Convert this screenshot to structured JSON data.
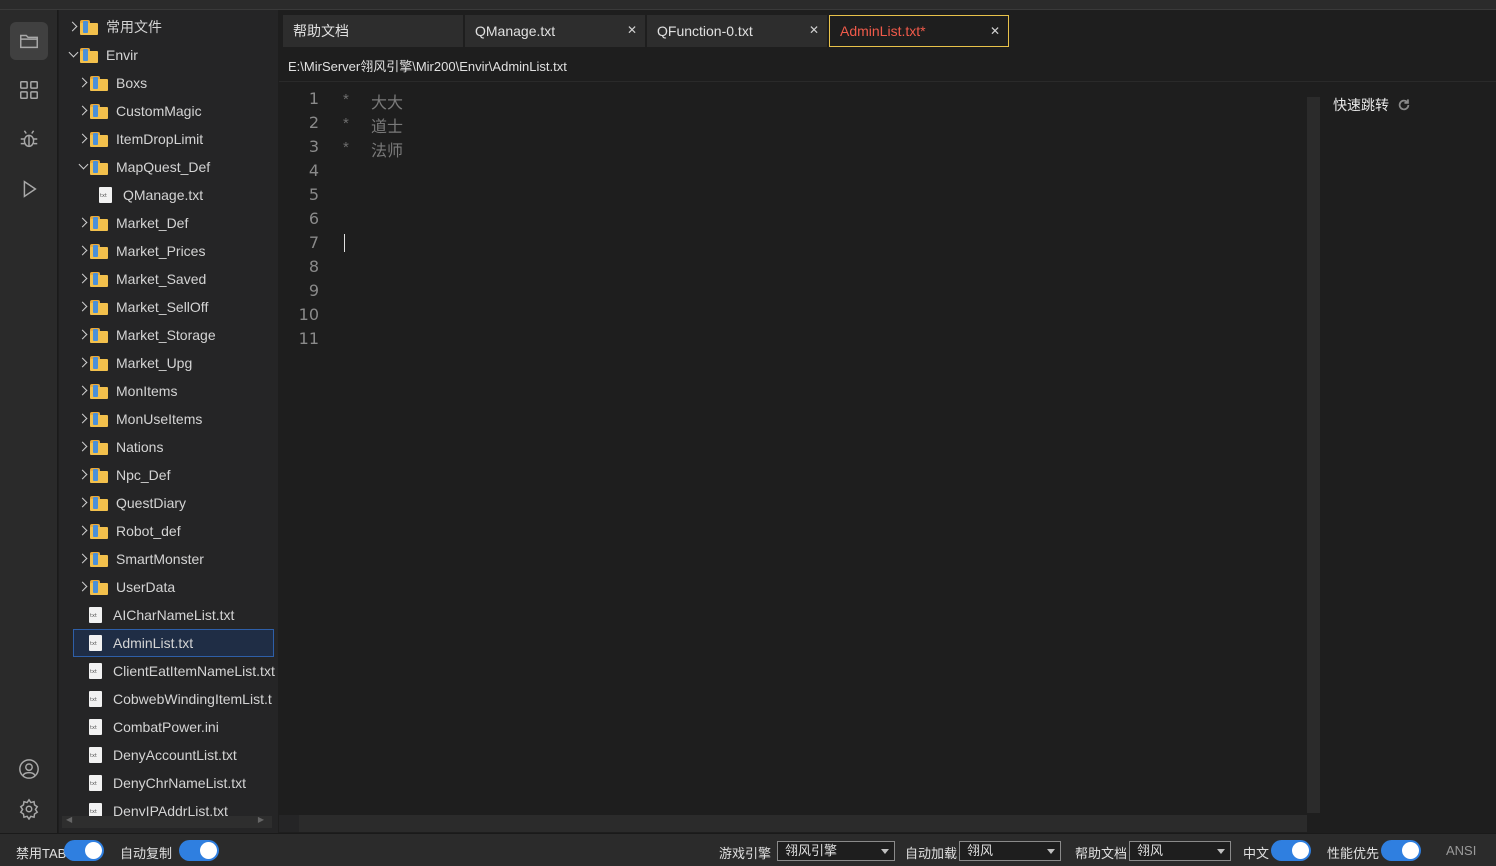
{
  "tree": [
    {
      "label": "常用文件",
      "type": "folder",
      "chev": "right"
    },
    {
      "label": "Envir",
      "type": "folder",
      "chev": "open"
    },
    {
      "label": "Boxs",
      "type": "folder",
      "chev": "right"
    },
    {
      "label": "CustomMagic",
      "type": "folder",
      "chev": "right"
    },
    {
      "label": "ItemDropLimit",
      "type": "folder",
      "chev": "right"
    },
    {
      "label": "MapQuest_Def",
      "type": "folder",
      "chev": "open"
    },
    {
      "label": "QManage.txt",
      "type": "file",
      "chev": "none"
    },
    {
      "label": "Market_Def",
      "type": "folder",
      "chev": "right"
    },
    {
      "label": "Market_Prices",
      "type": "folder",
      "chev": "right"
    },
    {
      "label": "Market_Saved",
      "type": "folder",
      "chev": "right"
    },
    {
      "label": "Market_SellOff",
      "type": "folder",
      "chev": "right"
    },
    {
      "label": "Market_Storage",
      "type": "folder",
      "chev": "right"
    },
    {
      "label": "Market_Upg",
      "type": "folder",
      "chev": "right"
    },
    {
      "label": "MonItems",
      "type": "folder",
      "chev": "right"
    },
    {
      "label": "MonUseItems",
      "type": "folder",
      "chev": "right"
    },
    {
      "label": "Nations",
      "type": "folder",
      "chev": "right"
    },
    {
      "label": "Npc_Def",
      "type": "folder",
      "chev": "right"
    },
    {
      "label": "QuestDiary",
      "type": "folder",
      "chev": "right"
    },
    {
      "label": "Robot_def",
      "type": "folder",
      "chev": "right"
    },
    {
      "label": "SmartMonster",
      "type": "folder",
      "chev": "right"
    },
    {
      "label": "UserData",
      "type": "folder",
      "chev": "right"
    },
    {
      "label": "AICharNameList.txt",
      "type": "file",
      "chev": "none"
    },
    {
      "label": "AdminList.txt",
      "type": "file",
      "chev": "none",
      "selected": true
    },
    {
      "label": "ClientEatItemNameList.txt",
      "type": "file",
      "chev": "none"
    },
    {
      "label": "CobwebWindingItemList.t",
      "type": "file",
      "chev": "none"
    },
    {
      "label": "CombatPower.ini",
      "type": "file",
      "chev": "none"
    },
    {
      "label": "DenyAccountList.txt",
      "type": "file",
      "chev": "none"
    },
    {
      "label": "DenyChrNameList.txt",
      "type": "file",
      "chev": "none"
    },
    {
      "label": "DenyIPAddrList.txt",
      "type": "file",
      "chev": "none"
    }
  ],
  "tabs": [
    {
      "label": "帮助文档",
      "closable": false
    },
    {
      "label": "QManage.txt",
      "closable": true
    },
    {
      "label": "QFunction-0.txt",
      "closable": true
    },
    {
      "label": "AdminList.txt*",
      "closable": true,
      "active": true
    }
  ],
  "path": "E:\\MirServer翎风引擎\\Mir200\\Envir\\AdminList.txt",
  "editor": {
    "line_numbers": [
      "1",
      "2",
      "3",
      "4",
      "5",
      "6",
      "7",
      "8",
      "9",
      "10",
      "11"
    ],
    "lines": [
      {
        "marker": "*",
        "text": "大大"
      },
      {
        "marker": "*",
        "text": "道士"
      },
      {
        "marker": "*",
        "text": "法师"
      }
    ],
    "cursor_line": 7
  },
  "quick_jump": {
    "title": "快速跳转"
  },
  "status": {
    "disable_tab": "禁用TAB",
    "auto_copy": "自动复制",
    "engine_label": "游戏引擎",
    "engine_value": "翎风引擎",
    "autoload_label": "自动加载",
    "autoload_value": "翎风",
    "help_label": "帮助文档",
    "help_value": "翎风",
    "chinese": "中文",
    "perf": "性能优先",
    "encoding": "ANSI"
  },
  "colors": {
    "accent": "#2f7fe0",
    "active_tab_text": "#f05a4a",
    "active_tab_border": "#e8c24a",
    "folder": "#f2c04c"
  }
}
